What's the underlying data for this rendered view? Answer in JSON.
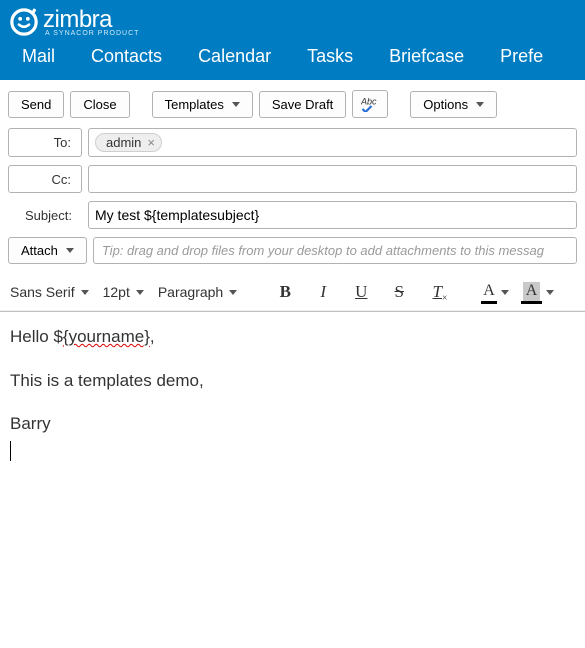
{
  "brand": {
    "name": "zimbra",
    "tagline": "A SYNACOR PRODUCT"
  },
  "nav": {
    "mail": "Mail",
    "contacts": "Contacts",
    "calendar": "Calendar",
    "tasks": "Tasks",
    "briefcase": "Briefcase",
    "preferences": "Prefe"
  },
  "toolbar": {
    "send": "Send",
    "close": "Close",
    "templates": "Templates",
    "save_draft": "Save Draft",
    "options": "Options"
  },
  "fields": {
    "to_label": "To:",
    "to_chip": "admin",
    "cc_label": "Cc:",
    "subject_label": "Subject:",
    "subject_value": "My test ${templatesubject}"
  },
  "attach": {
    "label": "Attach",
    "tip": "Tip: drag and drop files from your desktop to add attachments to this messag"
  },
  "format": {
    "font": "Sans Serif",
    "size": "12pt",
    "para": "Paragraph"
  },
  "body": {
    "greeting_pre": "Hello $",
    "greeting_mid": "{yourname}",
    "greeting_post": ",",
    "line2": "This is a templates demo,",
    "sig": "Barry"
  }
}
